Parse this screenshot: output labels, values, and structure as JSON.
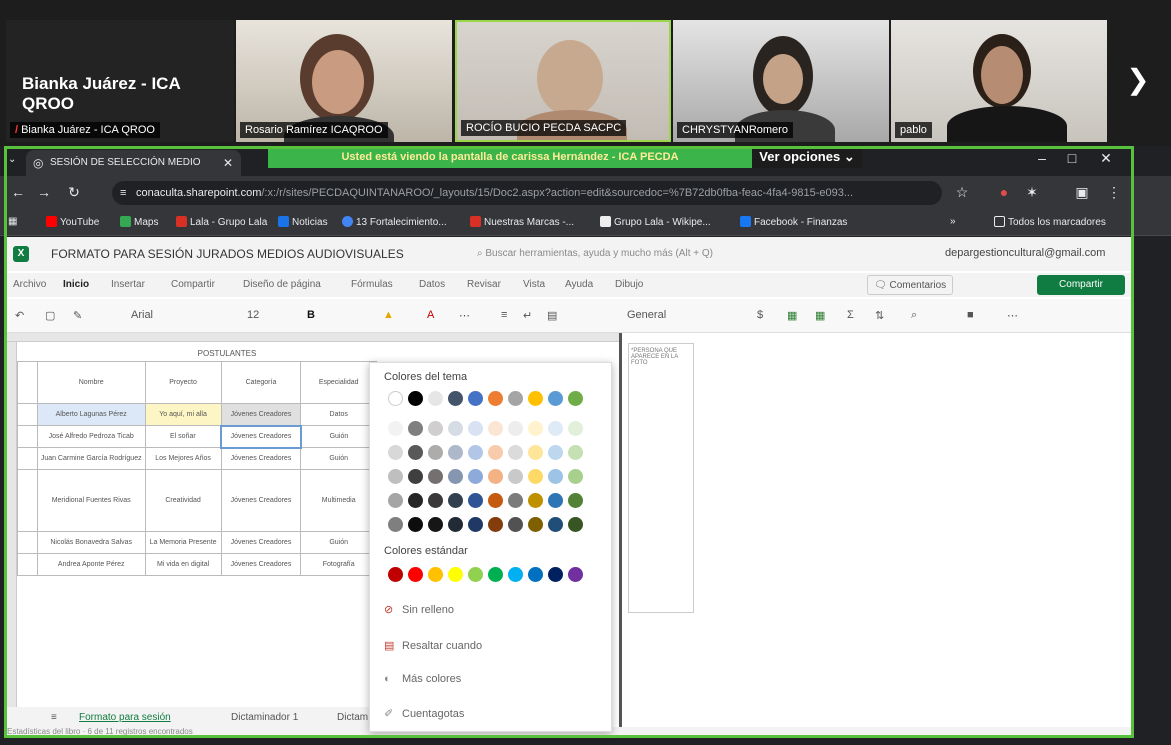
{
  "video_tiles": [
    {
      "name": "Bianka Juárez - ICA QROO",
      "big_name": "Bianka Juárez - ICA QROO"
    },
    {
      "name": "Rosario Ramírez ICAQROO"
    },
    {
      "name": "ROCÍO BUCIO PECDA SACPC"
    },
    {
      "name": "CHRYSTYANRomero"
    },
    {
      "name": "pablo"
    }
  ],
  "browser": {
    "tab_title": "SESIÓN DE SELECCIÓN MEDIO",
    "share_banner": "Usted está viendo la pantalla de carissa Hernández - ICA PECDA",
    "options_button": "Ver opciones",
    "url_domain": "conaculta.sharepoint.com",
    "url_path": "/:x:/r/sites/PECDAQUINTANAROO/_layouts/15/Doc2.aspx?action=edit&sourcedoc=%7B72db0fba-feac-4fa4-9815-e093...",
    "bookmarks": [
      "YouTube",
      "Maps",
      "Lala - Grupo Lala",
      "Noticias",
      "13 Fortalecimiento...",
      "Nuestras Marcas -...",
      "Grupo Lala - Wikipe...",
      "Facebook - Finanzas",
      "Todos los marcadores"
    ]
  },
  "excel": {
    "doc_title": "FORMATO PARA SESIÓN JURADOS MEDIOS AUDIOVISUALES",
    "search_placeholder": "Buscar herramientas, ayuda y mucho más (Alt + Q)",
    "account": "depargestioncultural@gmail.com",
    "menu": [
      "Archivo",
      "Inicio",
      "Insertar",
      "Compartir",
      "Diseño de página",
      "Fórmulas",
      "Datos",
      "Revisar",
      "Vista",
      "Ayuda",
      "Dibujo"
    ],
    "comments_button": "Comentarios",
    "share_button": "Compartir",
    "ribbon": {
      "font": "Arial",
      "size": "12",
      "bold": "B",
      "format": "General"
    },
    "sheet_heading": "POSTULANTES",
    "table_headers": [
      "Nombre",
      "Proyecto",
      "Categoría",
      "Especialidad"
    ],
    "table_rows": [
      [
        "Alberto Lagunas Pérez",
        "Yo aquí, mi alla",
        "Jóvenes Creadores",
        "Datos"
      ],
      [
        "José Alfredo Pedroza Ticab",
        "El soñar",
        "Jóvenes Creadores",
        "Guión"
      ],
      [
        "Juan Carmine García Rodríguez",
        "Los Mejores Años",
        "Jóvenes Creadores",
        "Guión"
      ],
      [
        "Meridional Fuentes Rivas",
        "Creatividad",
        "Jóvenes Creadores",
        "Multimedia"
      ],
      [
        "Nicolás Bonavedra Salvas",
        "La Memoria Presente",
        "Jóvenes Creadores",
        "Guión"
      ],
      [
        "Andrea Aponte Pérez",
        "Mi vida en digital",
        "Jóvenes Creadores",
        "Fotografía"
      ]
    ],
    "sheet_tabs": [
      "Formato para sesión",
      "Dictaminador 1",
      "Dictam"
    ],
    "status": "Estadísticas del libro · 6 de 11 registros encontrados",
    "right_col_text": "*PERSONA QUE APARECE EN LA FOTO"
  },
  "color_popup": {
    "theme_heading": "Colores del tema",
    "standard_heading": "Colores estándar",
    "theme_colors": [
      [
        "#ffffff",
        "#000000",
        "#e7e6e6",
        "#44546a",
        "#4472c4",
        "#ed7d31",
        "#a5a5a5",
        "#ffc000",
        "#5b9bd5",
        "#70ad47"
      ],
      [
        "#f2f2f2",
        "#7f7f7f",
        "#d0cece",
        "#d6dce4",
        "#d9e2f3",
        "#fbe5d5",
        "#ededed",
        "#fff2cc",
        "#deebf6",
        "#e2efd9"
      ],
      [
        "#d8d8d8",
        "#595959",
        "#aeabab",
        "#adb9ca",
        "#b4c6e7",
        "#f7cbac",
        "#dbdbdb",
        "#fee599",
        "#bdd7ee",
        "#c5e0b3"
      ],
      [
        "#bfbfbf",
        "#3f3f3f",
        "#757070",
        "#8496b0",
        "#8eaadb",
        "#f4b183",
        "#c9c9c9",
        "#ffd965",
        "#9dc3e6",
        "#a8d08d"
      ],
      [
        "#a5a5a5",
        "#262626",
        "#3a3838",
        "#323f4f",
        "#2f5496",
        "#c55a11",
        "#7b7b7b",
        "#bf9000",
        "#2e75b5",
        "#538135"
      ],
      [
        "#7f7f7f",
        "#0d0d0d",
        "#171616",
        "#222a35",
        "#1f3864",
        "#833c0b",
        "#525252",
        "#7f6000",
        "#1f4e79",
        "#375623"
      ]
    ],
    "standard_colors": [
      "#c00000",
      "#ff0000",
      "#ffc000",
      "#ffff00",
      "#92d050",
      "#00b050",
      "#00b0f0",
      "#0070c0",
      "#002060",
      "#7030a0"
    ],
    "options": [
      "Sin relleno",
      "Resaltar cuando",
      "Más colores",
      "Cuentagotas"
    ]
  }
}
